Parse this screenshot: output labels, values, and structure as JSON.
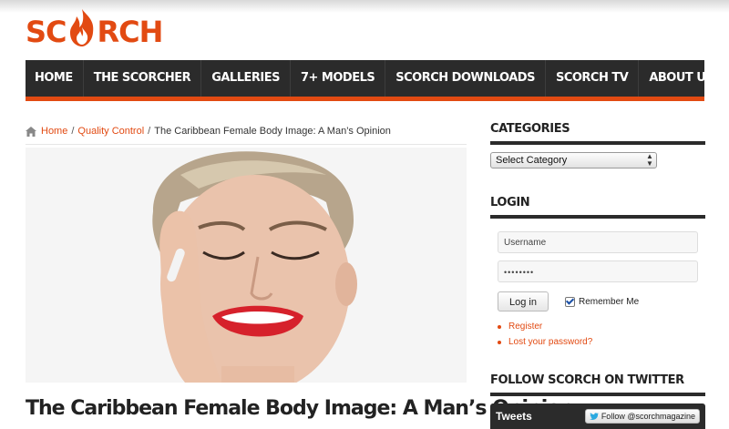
{
  "logo": {
    "text_before": "SC",
    "text_after": "RCH",
    "alt": "SCORCH"
  },
  "nav": [
    {
      "label": "HOME"
    },
    {
      "label": "THE SCORCHER"
    },
    {
      "label": "GALLERIES"
    },
    {
      "label": "7+ MODELS"
    },
    {
      "label": "SCORCH DOWNLOADS"
    },
    {
      "label": "SCORCH TV"
    },
    {
      "label": "ABOUT US »"
    }
  ],
  "breadcrumb": {
    "home": "Home",
    "category": "Quality Control",
    "current": "The Caribbean Female Body Image: A Man’s Opinion",
    "separator": "/"
  },
  "post": {
    "title": "The Caribbean Female Body Image: A Man’s Opinion"
  },
  "sidebar": {
    "categories": {
      "title": "CATEGORIES",
      "select_value": "Select Category"
    },
    "login": {
      "title": "LOGIN",
      "username_placeholder": "Username",
      "password_value": "••••••••",
      "button_label": "Log in",
      "remember_label": "Remember Me",
      "register_link": "Register",
      "lost_password_link": "Lost your password?"
    },
    "twitter": {
      "title": "FOLLOW SCORCH ON TWITTER",
      "tweets_label": "Tweets",
      "follow_button": "Follow @scorchmagazine"
    }
  },
  "colors": {
    "accent": "#e24a12",
    "nav_bg": "#2b2b2b"
  }
}
